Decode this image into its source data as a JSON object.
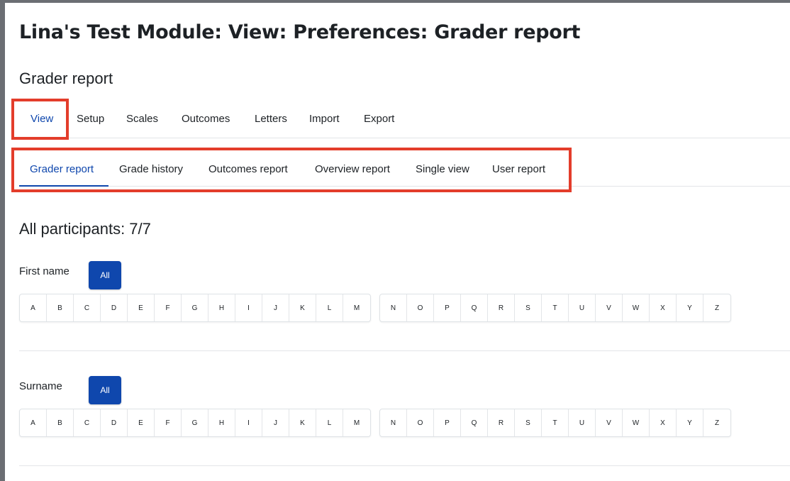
{
  "page_title": "Lina's Test Module: View: Preferences: Grader report",
  "sub_title": "Grader report",
  "primary_tabs": [
    {
      "label": "View",
      "active": true
    },
    {
      "label": "Setup",
      "active": false
    },
    {
      "label": "Scales",
      "active": false
    },
    {
      "label": "Outcomes",
      "active": false
    },
    {
      "label": "Letters",
      "active": false
    },
    {
      "label": "Import",
      "active": false
    },
    {
      "label": "Export",
      "active": false
    }
  ],
  "secondary_tabs": [
    {
      "label": "Grader report",
      "active": true
    },
    {
      "label": "Grade history",
      "active": false
    },
    {
      "label": "Outcomes report",
      "active": false
    },
    {
      "label": "Overview report",
      "active": false
    },
    {
      "label": "Single view",
      "active": false
    },
    {
      "label": "User report",
      "active": false
    }
  ],
  "participants_heading": "All participants: 7/7",
  "filters": {
    "first_name": {
      "label": "First name",
      "all_label": "All",
      "letters_a_m": [
        "A",
        "B",
        "C",
        "D",
        "E",
        "F",
        "G",
        "H",
        "I",
        "J",
        "K",
        "L",
        "M"
      ],
      "letters_n_z": [
        "N",
        "O",
        "P",
        "Q",
        "R",
        "S",
        "T",
        "U",
        "V",
        "W",
        "X",
        "Y",
        "Z"
      ]
    },
    "surname": {
      "label": "Surname",
      "all_label": "All",
      "letters_a_m": [
        "A",
        "B",
        "C",
        "D",
        "E",
        "F",
        "G",
        "H",
        "I",
        "J",
        "K",
        "L",
        "M"
      ],
      "letters_n_z": [
        "N",
        "O",
        "P",
        "Q",
        "R",
        "S",
        "T",
        "U",
        "V",
        "W",
        "X",
        "Y",
        "Z"
      ]
    }
  },
  "colors": {
    "accent": "#0f47ad",
    "highlight": "#e33d2b",
    "text": "#1d2125"
  }
}
